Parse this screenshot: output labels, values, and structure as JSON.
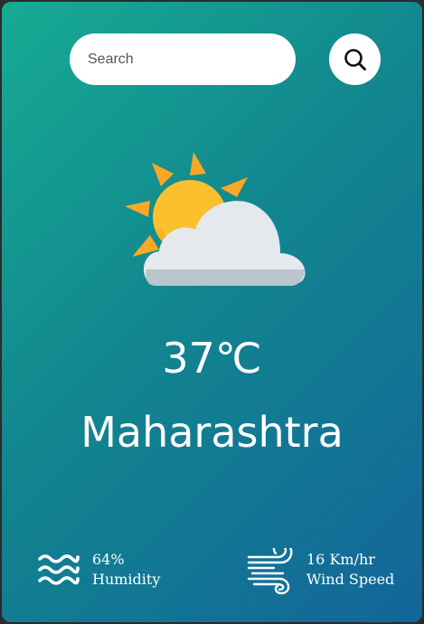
{
  "search": {
    "placeholder": "Search",
    "value": "",
    "button_icon": "search-icon"
  },
  "weather": {
    "icon": "partly-cloudy-icon",
    "temperature": "37℃",
    "city": "Maharashtra"
  },
  "stats": {
    "humidity": {
      "icon": "humidity-icon",
      "value": "64%",
      "label": "Humidity"
    },
    "wind": {
      "icon": "wind-icon",
      "value": "16 Km/hr",
      "label": "Wind Speed"
    }
  },
  "colors": {
    "gradient_start": "#17ab93",
    "gradient_end": "#13659a",
    "sun": "#fbc02d",
    "sun_rays": "#f9a825",
    "cloud": "#e3e9ec"
  }
}
